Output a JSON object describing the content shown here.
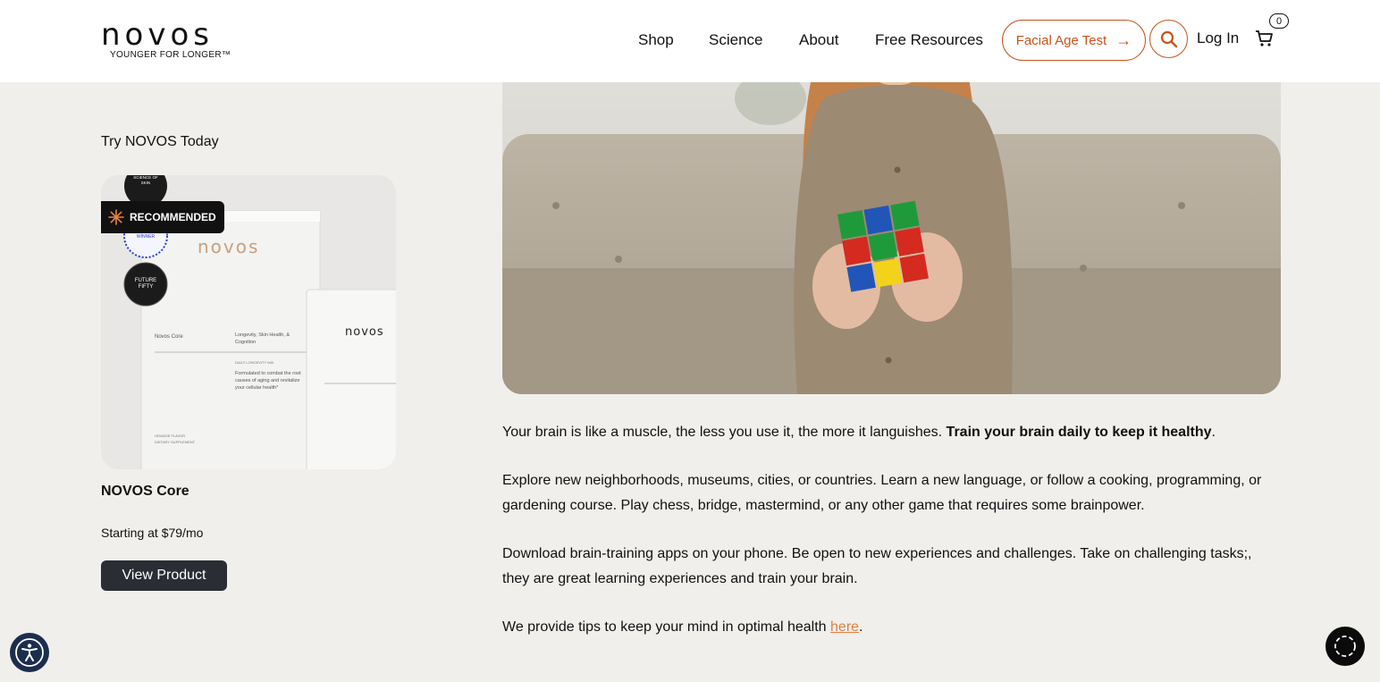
{
  "brand": {
    "name": "novos",
    "tagline": "YOUNGER FOR LONGER™"
  },
  "nav": {
    "items": [
      "Shop",
      "Science",
      "About",
      "Free Resources"
    ],
    "cta_label": "Facial Age Test",
    "login_label": "Log In",
    "cart_count": "0"
  },
  "sidebar": {
    "title": "Try NOVOS Today",
    "badge_label": "RECOMMENDED",
    "product_name": "NOVOS Core",
    "price": "Starting at $79/mo",
    "button_label": "View Product",
    "package": {
      "brand": "novos",
      "product": "Novos Core",
      "benefits": "Longevity, Skin Health, & Cognition",
      "mix": "DAILY LONGEVITY MIX",
      "desc": "Formulated to combat the root causes of aging and revitalize your cellular health*",
      "flavor": "ORANGE FLAVOR",
      "type": "DIETARY SUPPLEMENT",
      "seal1": "SCIENCE OF SKIN",
      "seal2": "WINNER",
      "seal3": "FUTURE FIFTY"
    }
  },
  "article": {
    "p1_text": "Your brain is like a muscle, the less you use it, the more it languishes. ",
    "p1_bold": "Train your brain daily to keep it healthy",
    "p1_end": ".",
    "p2": "Explore new neighborhoods, museums, cities, or countries. Learn a new language, or follow a cooking, programming, or gardening course. Play chess, bridge, mastermind, or any other game that requires some brainpower.",
    "p3": "Download brain-training apps on your phone. Be open to new experiences and challenges. Take on challenging tasks;, they are great learning experiences and train your brain.",
    "p4_text": "We provide tips to keep your mind in optimal health ",
    "p4_link": "here",
    "p4_end": "."
  },
  "colors": {
    "accent": "#c6531c",
    "link": "#e07f3f",
    "background": "#f0efec",
    "button_dark": "#2a2d33"
  }
}
